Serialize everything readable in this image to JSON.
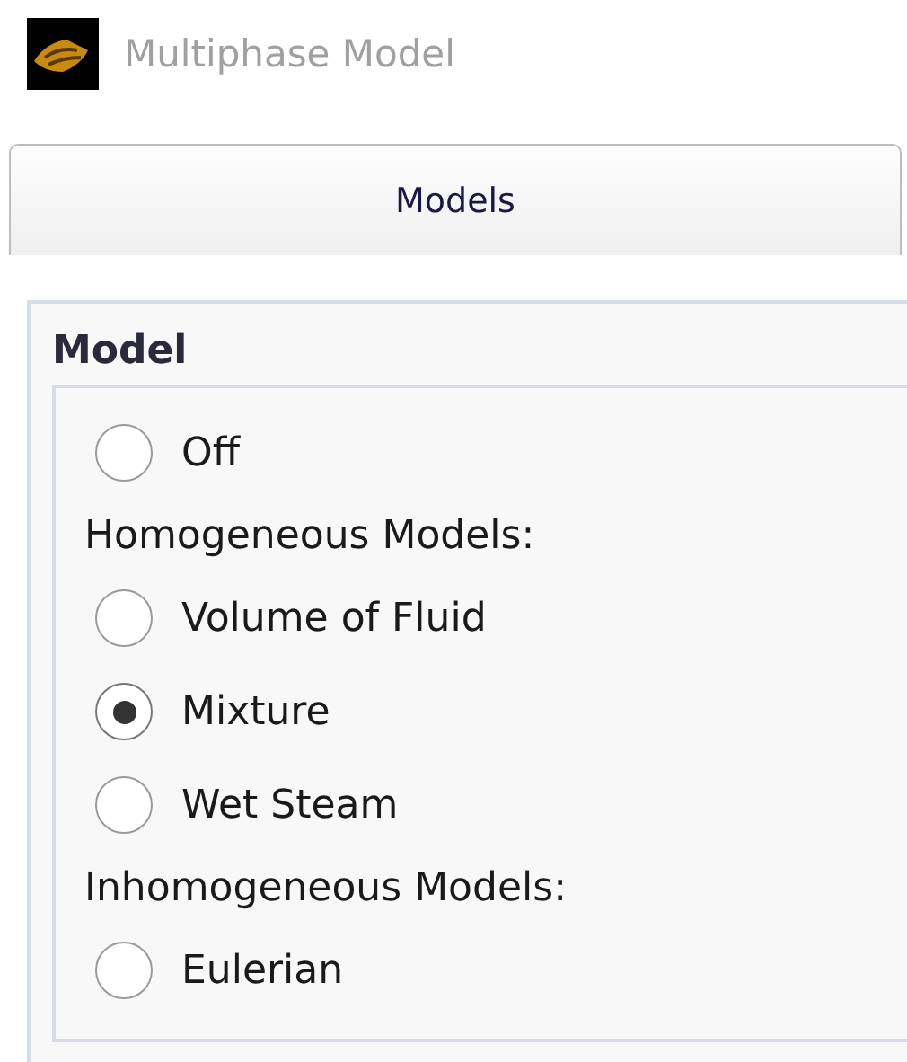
{
  "window": {
    "title": "Multiphase Model"
  },
  "tabs": [
    {
      "label": "Models",
      "selected": true
    }
  ],
  "group": {
    "title": "Model",
    "items": [
      {
        "kind": "radio",
        "label": "Off",
        "selected": false
      },
      {
        "kind": "heading",
        "label": "Homogeneous Models:"
      },
      {
        "kind": "radio",
        "label": "Volume of Fluid",
        "selected": false
      },
      {
        "kind": "radio",
        "label": "Mixture",
        "selected": true
      },
      {
        "kind": "radio",
        "label": "Wet Steam",
        "selected": false
      },
      {
        "kind": "heading",
        "label": "Inhomogeneous Models:"
      },
      {
        "kind": "radio",
        "label": "Eulerian",
        "selected": false
      }
    ]
  }
}
